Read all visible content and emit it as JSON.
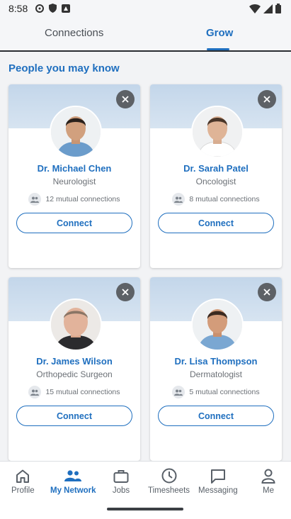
{
  "status": {
    "time": "8:58"
  },
  "tabs": [
    {
      "label": "Connections",
      "active": false
    },
    {
      "label": "Grow",
      "active": true
    }
  ],
  "section": {
    "title": "People you may know"
  },
  "people": [
    {
      "name": "Dr. Michael Chen",
      "title": "Neurologist",
      "mutual": "12 mutual connections",
      "connect_label": "Connect"
    },
    {
      "name": "Dr. Sarah Patel",
      "title": "Oncologist",
      "mutual": "8 mutual connections",
      "connect_label": "Connect"
    },
    {
      "name": "Dr. James Wilson",
      "title": "Orthopedic Surgeon",
      "mutual": "15 mutual connections",
      "connect_label": "Connect"
    },
    {
      "name": "Dr. Lisa Thompson",
      "title": "Dermatologist",
      "mutual": "5 mutual connections",
      "connect_label": "Connect"
    }
  ],
  "nav": [
    {
      "label": "Profile",
      "icon": "home-icon",
      "active": false
    },
    {
      "label": "My Network",
      "icon": "people-icon",
      "active": true
    },
    {
      "label": "Jobs",
      "icon": "briefcase-icon",
      "active": false
    },
    {
      "label": "Timesheets",
      "icon": "clock-icon",
      "active": false
    },
    {
      "label": "Messaging",
      "icon": "chat-icon",
      "active": false
    },
    {
      "label": "Me",
      "icon": "person-icon",
      "active": false
    }
  ],
  "colors": {
    "accent": "#1f6fbf",
    "banner": "#c3d6ea",
    "dismiss": "#5d6166"
  }
}
